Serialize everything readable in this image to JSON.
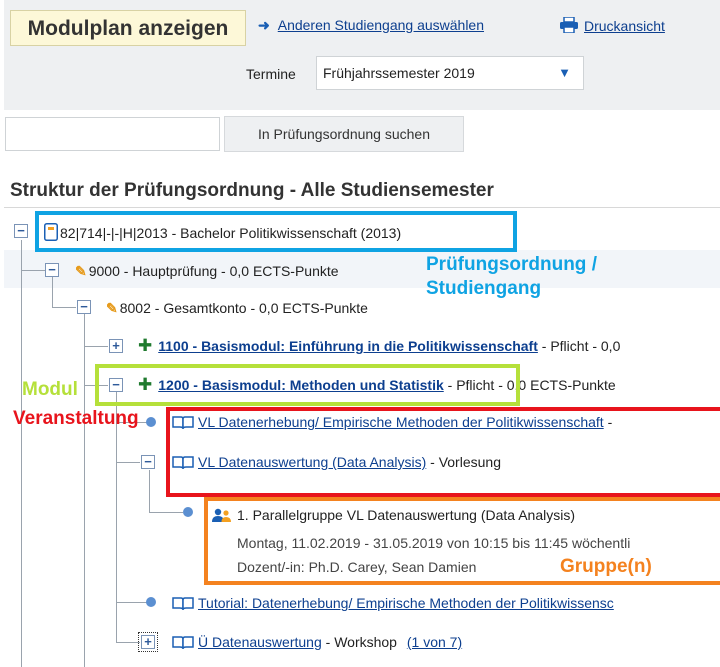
{
  "header": {
    "title": "Modulplan anzeigen",
    "change_link": "Anderen Studiengang auswählen",
    "print_link": "Druckansicht",
    "termine_label": "Termine",
    "termine_value": "Frühjahrssemester 2019"
  },
  "search": {
    "button_label": "In Prüfungsordnung suchen"
  },
  "structure": {
    "title": "Struktur der Prüfungsordnung - Alle Studiensemester"
  },
  "tree": {
    "root": "82|714|-|-|H|2013 - Bachelor Politikwissenschaft (2013)",
    "hauptpruefung": "9000 - Hauptprüfung - 0,0 ECTS-Punkte",
    "gesamtkonto": "8002 - Gesamtkonto - 0,0 ECTS-Punkte",
    "mod1100_link": "1100 - Basismodul: Einführung in die Politikwissenschaft",
    "mod1100_suffix": "- Pflicht - 0,0",
    "mod1200_link": "1200 - Basismodul: Methoden und Statistik",
    "mod1200_suffix": "- Pflicht - 0,0 ECTS-Punkte",
    "vl1_link": "VL Datenerhebung/ Empirische Methoden der Politikwissenschaft",
    "vl1_suffix": "-",
    "vl2_link": "VL Datenauswertung (Data Analysis)",
    "vl2_suffix": "- Vorlesung",
    "group_title": "1. Parallelgruppe VL Datenauswertung (Data Analysis)",
    "group_dates": "Montag, 11.02.2019 - 31.05.2019 von 10:15 bis 11:45 wöchentli",
    "group_lecturer": "Dozent/-in: Ph.D. Carey, Sean Damien",
    "tutorial_link": "Tutorial: Datenerhebung/ Empirische Methoden der Politikwissensc",
    "ue_link": "Ü Datenauswertung",
    "ue_suffix": "- Workshop",
    "pager": "(1 von 7)"
  },
  "annotations": {
    "pruefungsordnung": "Prüfungsordnung /",
    "studiengang": "Studiengang",
    "modul": "Modul",
    "veranstaltung": "Veranstaltung",
    "gruppe": "Gruppe(n)"
  },
  "colors": {
    "blue_box": "#0fa3e3",
    "green_box": "#b5e03a",
    "red_box": "#e8141c",
    "orange_box": "#f4821f",
    "module_icon": "#1f7a2e",
    "link": "#0d3f8f"
  },
  "icons": {
    "change": "arrow-right-icon",
    "print": "printer-icon",
    "root": "document-icon",
    "exam": "pencil-icon",
    "module": "puzzle-icon",
    "course": "book-icon",
    "group": "people-icon"
  }
}
